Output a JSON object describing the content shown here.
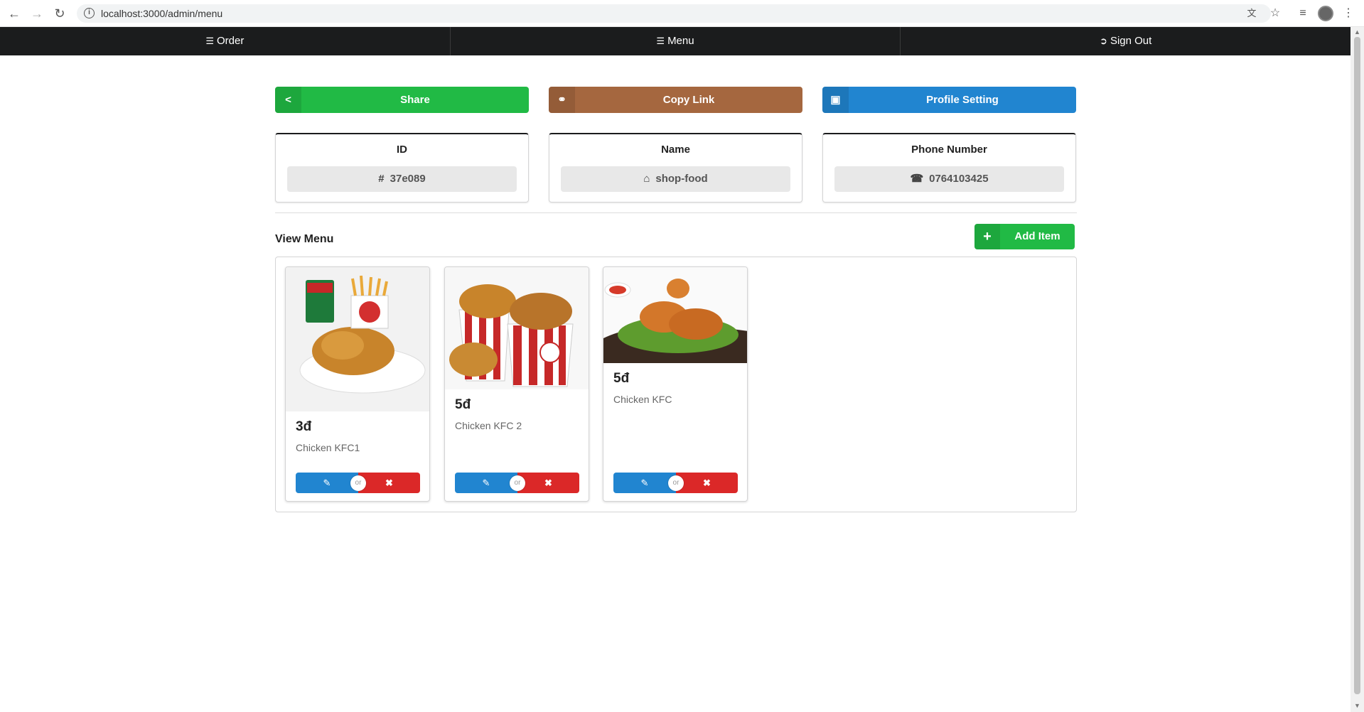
{
  "browser": {
    "url": "localhost:3000/admin/menu",
    "back_icon": "arrow-left-icon",
    "forward_icon": "arrow-right-icon",
    "reload_icon": "reload-icon"
  },
  "navbar": {
    "items": [
      {
        "label": "Order",
        "icon": "list-icon"
      },
      {
        "label": "Menu",
        "icon": "list-icon"
      },
      {
        "label": "Sign Out",
        "icon": "sign-out-icon"
      }
    ]
  },
  "actions": {
    "share": {
      "label": "Share",
      "color": "#21ba45"
    },
    "copy_link": {
      "label": "Copy Link",
      "color": "#a5673f"
    },
    "profile_setting": {
      "label": "Profile Setting",
      "color": "#2185d0"
    }
  },
  "info": {
    "id": {
      "header": "ID",
      "value": "37e089"
    },
    "name": {
      "header": "Name",
      "value": "shop-food"
    },
    "phone": {
      "header": "Phone Number",
      "value": "0764103425"
    }
  },
  "menu": {
    "title": "View Menu",
    "add_label": "Add Item",
    "or_label": "or",
    "items": [
      {
        "price": "3đ",
        "name": "Chicken KFC1"
      },
      {
        "price": "5đ",
        "name": "Chicken KFC 2"
      },
      {
        "price": "5đ",
        "name": "Chicken KFC"
      }
    ]
  }
}
